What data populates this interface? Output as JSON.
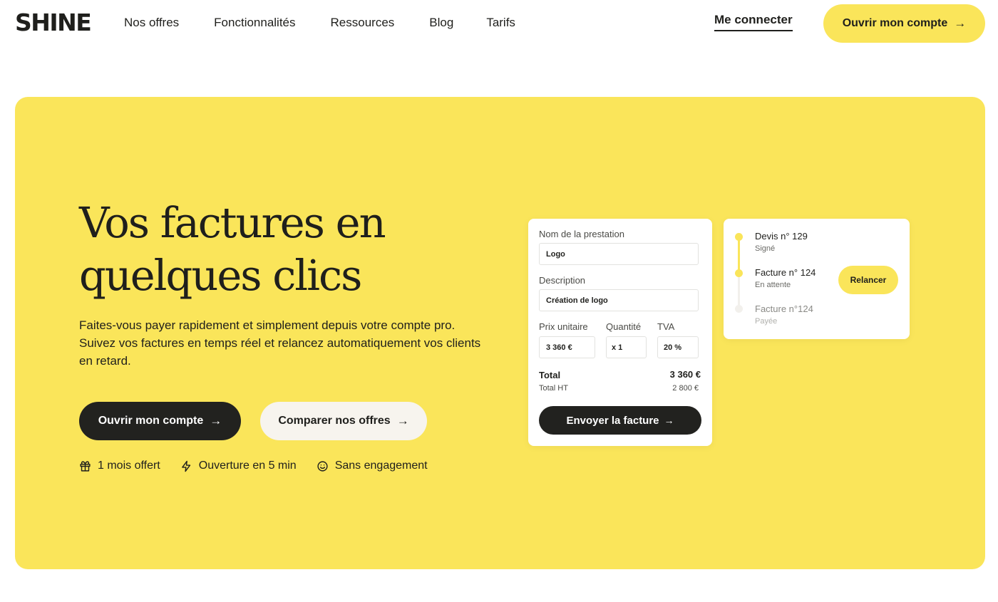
{
  "brand": {
    "logo": "SHINE"
  },
  "nav": {
    "links": [
      "Nos offres",
      "Fonctionnalités",
      "Ressources",
      "Blog",
      "Tarifs"
    ],
    "login": "Me connecter",
    "cta": "Ouvrir mon compte"
  },
  "hero": {
    "title_line1": "Vos factures en",
    "title_line2": "quelques clics",
    "description": "Faites-vous payer rapidement et simplement depuis votre compte pro. Suivez vos factures en temps réel et relancez automatiquement vos clients en retard.",
    "primary_cta": "Ouvrir mon compte",
    "secondary_cta": "Comparer nos offres",
    "perks": [
      "1 mois offert",
      "Ouverture en 5 min",
      "Sans engagement"
    ]
  },
  "invoice_form": {
    "service_label": "Nom de la prestation",
    "service_value": "Logo",
    "description_label": "Description",
    "description_value": "Création de logo",
    "unit_price_label": "Prix unitaire",
    "unit_price_value": "3 360 €",
    "quantity_label": "Quantité",
    "quantity_value": "x 1",
    "vat_label": "TVA",
    "vat_value": "20 %",
    "total_label": "Total",
    "total_value": "3 360 €",
    "total_ht_label": "Total HT",
    "total_ht_value": "2 800 €",
    "send_button": "Envoyer la facture"
  },
  "status_card": {
    "items": [
      {
        "title": "Devis n° 129",
        "status": "Signé"
      },
      {
        "title": "Facture n° 124",
        "status": "En attente"
      },
      {
        "title": "Facture n°124",
        "status": "Payée"
      }
    ],
    "remind_button": "Relancer"
  },
  "colors": {
    "accent": "#fae55a",
    "dark": "#22221f",
    "light_button": "#f7f4ee",
    "text": "#1f1f1c"
  }
}
